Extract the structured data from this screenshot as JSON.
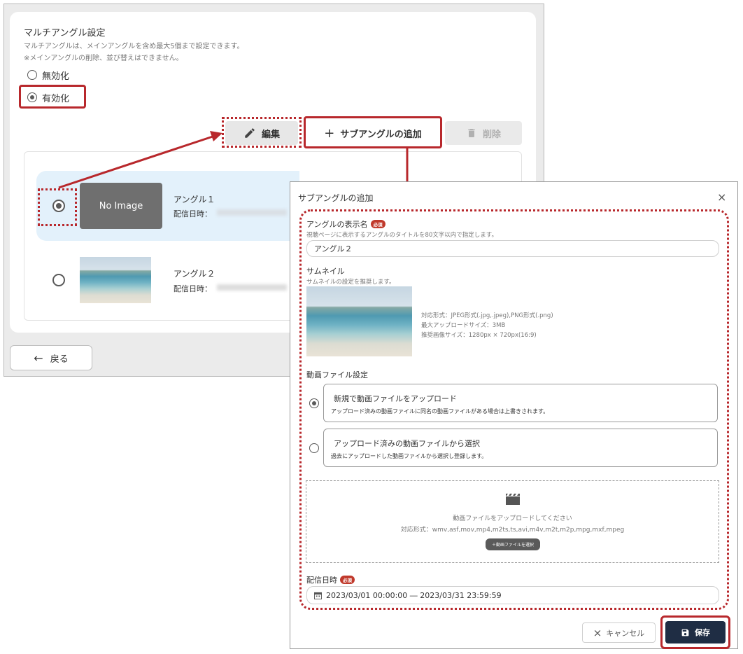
{
  "background": {
    "section_title": "マルチアングル設定",
    "desc1": "マルチアングルは、メインアングルを含め最大5個まで設定できます。",
    "desc2": "※メインアングルの削除、並び替えはできません。",
    "disable_label": "無効化",
    "enable_label": "有効化",
    "toolbar": {
      "edit": "編集",
      "add": "サブアングルの追加",
      "delete": "削除"
    },
    "angles": [
      {
        "name": "アングル１",
        "date_label": "配信日時：",
        "thumb_text": "No Image"
      },
      {
        "name": "アングル２",
        "date_label": "配信日時："
      }
    ],
    "back_label": "戻る"
  },
  "dialog": {
    "title": "サブアングルの追加",
    "name_label": "アングルの表示名",
    "required": "必須",
    "name_help": "視聴ページに表示するアングルのタイトルを80文字以内で指定します。",
    "name_value": "アングル２",
    "thumb_label": "サムネイル",
    "thumb_help": "サムネイルの設定を推奨します。",
    "thumb_info": [
      "対応形式：JPEG形式(.jpg,.jpeg),PNG形式(.png)",
      "最大アップロードサイズ：3MB",
      "推奨画像サイズ：1280px × 720px(16:9)"
    ],
    "video_label": "動画ファイル設定",
    "options": [
      {
        "title": "新規で動画ファイルをアップロード",
        "desc": "アップロード済みの動画ファイルに同名の動画ファイルがある場合は上書きされます。"
      },
      {
        "title": "アップロード済みの動画ファイルから選択",
        "desc": "過去にアップロードした動画ファイルから選択し登録します。"
      }
    ],
    "upload_prompt": "動画ファイルをアップロードしてください",
    "upload_formats": "対応形式：wmv,asf,mov,mp4,m2ts,ts,avi,m4v,m2t,m2p,mpg,mxf,mpeg",
    "upload_button": "＋動画ファイルを選択",
    "date_label": "配信日時",
    "date_value": "2023/03/01 00:00:00 ― 2023/03/31 23:59:59",
    "cancel": "キャンセル",
    "save": "保存"
  },
  "colors": {
    "accent": "#b8282c",
    "primary": "#1f2d44",
    "selected_row": "#e3f1fb"
  }
}
